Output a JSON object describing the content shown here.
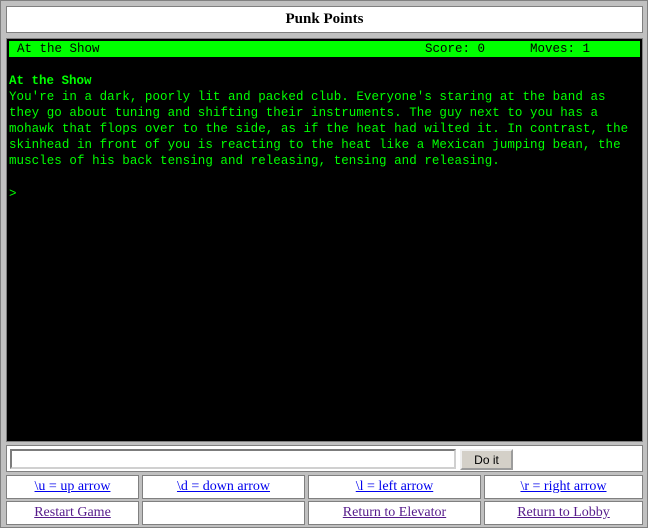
{
  "window": {
    "title": "Punk Points"
  },
  "status": {
    "location": "At the Show",
    "score_text": "Score: 0",
    "moves_text": "Moves: 1"
  },
  "output": {
    "room_name": "At the Show",
    "description": "You're in a dark, poorly lit and packed club. Everyone's staring at the band as they go about tuning and shifting their instruments. The guy next to you has a mohawk that flops over to the side, as if the heat had wilted it. In contrast, the skinhead in front of you is reacting to the heat like a Mexican jumping bean, the muscles of his back tensing and releasing, tensing and releasing.",
    "prompt": ">"
  },
  "command": {
    "value": "",
    "submit_label": "Do it"
  },
  "nav": {
    "up": "\\u = up arrow",
    "down": "\\d = down arrow",
    "left": "\\l = left arrow",
    "right": "\\r = right arrow",
    "restart": "Restart Game",
    "elevator": "Return to Elevator",
    "lobby": "Return to Lobby"
  },
  "colors": {
    "terminal_bg": "#000000",
    "terminal_text": "#00ff00",
    "status_bg": "#00ff00",
    "link": "#0000ee",
    "visited_link": "#551a8b"
  }
}
